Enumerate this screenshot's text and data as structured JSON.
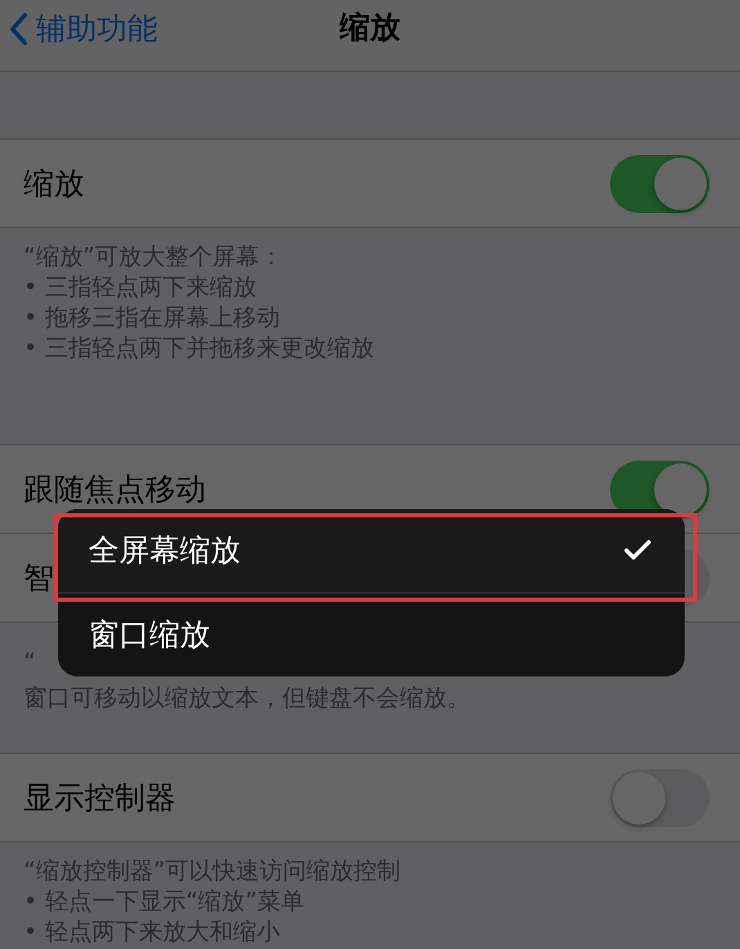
{
  "nav": {
    "back_label": "辅助功能",
    "title": "缩放"
  },
  "sections": [
    {
      "rows": [
        {
          "label": "缩放",
          "on": true
        }
      ],
      "footer": [
        "“缩放”可放大整个屏幕：",
        "•  三指轻点两下来缩放",
        "•  拖移三指在屏幕上移动",
        "•  三指轻点两下并拖移来更改缩放"
      ]
    },
    {
      "rows": [
        {
          "label": "跟随焦点移动",
          "on": true
        },
        {
          "label": "智",
          "on": false
        }
      ],
      "footer": [
        "“",
        "窗口可移动以缩放文本，但键盘不会缩放。"
      ]
    },
    {
      "rows": [
        {
          "label": "显示控制器",
          "on": false
        }
      ],
      "footer": [
        "“缩放控制器”可以快速访问缩放控制",
        "• 轻点一下显示“缩放”菜单",
        "• 轻点两下来放大和缩小"
      ]
    }
  ],
  "menu": {
    "items": [
      {
        "label": "全屏幕缩放",
        "selected": true
      },
      {
        "label": "窗口缩放",
        "selected": false
      }
    ]
  }
}
